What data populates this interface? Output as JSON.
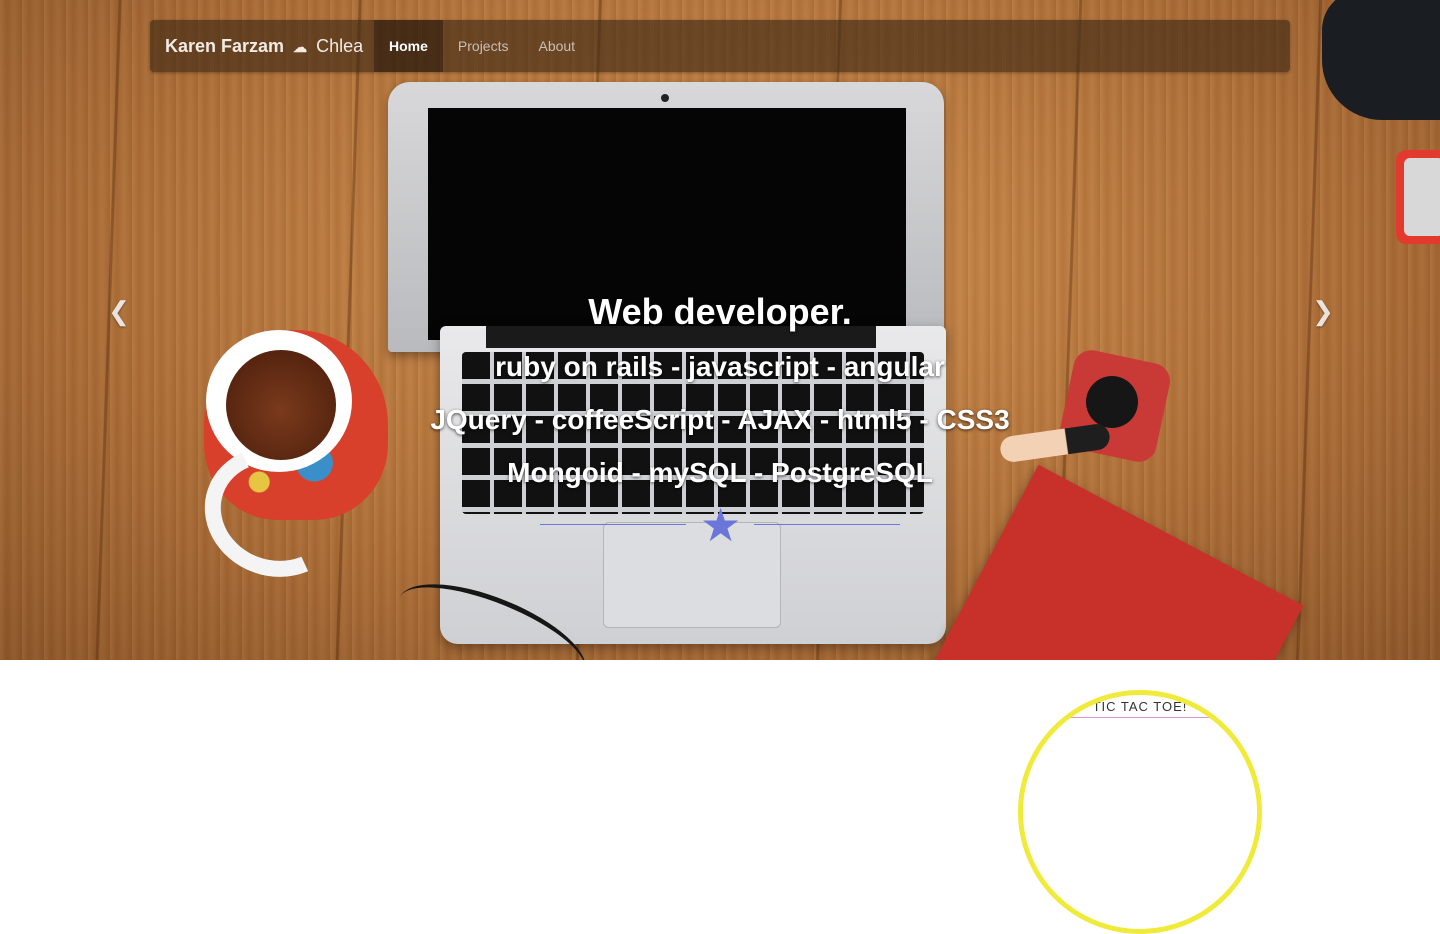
{
  "navbar": {
    "brand_name": "Karen Farzam",
    "brand_icon": "cloud-icon",
    "brand_suffix": "Chlea",
    "items": [
      {
        "label": "Home",
        "active": true
      },
      {
        "label": "Projects",
        "active": false
      },
      {
        "label": "About",
        "active": false
      }
    ]
  },
  "hero": {
    "heading": "Web developer.",
    "skills": [
      "ruby on rails - javascript - angular",
      "JQuery - coffeeScript - AJAX - html5 - CSS3",
      "Mongoid - mySQL - PostgreSQL"
    ],
    "divider_icon": "star-icon",
    "prev_icon": "chevron-left-icon",
    "next_icon": "chevron-right-icon"
  },
  "projects": {
    "preview_title": "TIC TAC TOE!"
  },
  "colors": {
    "divider": "#6a76da",
    "project_border": "#f0ea3a",
    "project_rule": "#d59ad2"
  }
}
